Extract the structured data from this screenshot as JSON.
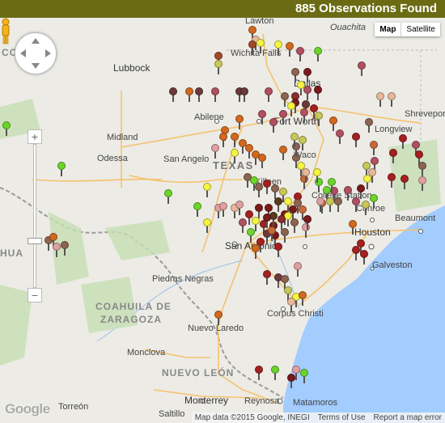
{
  "header": {
    "title": "885 Observations Found",
    "bg_color": "#6b6b14"
  },
  "map_type": {
    "map_label": "Map",
    "satellite_label": "Satellite",
    "selected": "Map"
  },
  "labels": {
    "region": [
      "CO",
      "HUA",
      "COAHUILA DE",
      "ZARAGOZA",
      "NUEVO LEÓN"
    ],
    "state": "TEXAS",
    "water": "Ouachita",
    "cities": [
      "Lawton",
      "Wichita Falls",
      "Lubbock",
      "Dallas",
      "Abilene",
      "Fort Worth",
      "Shreveport",
      "Midland",
      "Longview",
      "Odessa",
      "San Angelo",
      "Waco",
      "Killeen",
      "College Station",
      "Conroe",
      "Beaumont",
      "San Antonio",
      "Houston",
      "Galveston",
      "Piedras Negras",
      "Corpus Christi",
      "Nuevo Laredo",
      "Monclova",
      "Reynosa",
      "Matamoros",
      "Torreón",
      "Monterrey",
      "Saltillo"
    ]
  },
  "footer": {
    "attribution": "Map data ©2015 Google, INEGI",
    "terms": "Terms of Use",
    "report": "Report a map error"
  },
  "logo": "Google",
  "zoom": {
    "in": "+",
    "out": "−"
  }
}
